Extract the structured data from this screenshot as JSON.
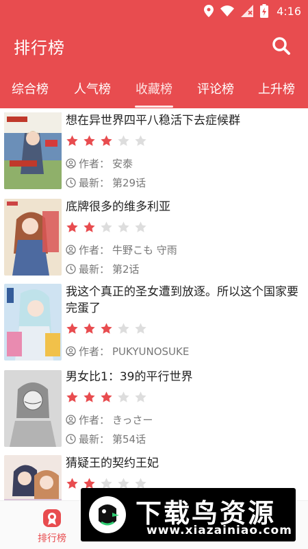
{
  "status_bar": {
    "time": "4:16"
  },
  "header": {
    "title": "排行榜"
  },
  "tabs": [
    {
      "label": "综合榜"
    },
    {
      "label": "人气榜"
    },
    {
      "label": "收藏榜"
    },
    {
      "label": "评论榜"
    },
    {
      "label": "上升榜"
    }
  ],
  "active_tab": "收藏榜",
  "author_prefix": "作者：",
  "latest_prefix": "最新：",
  "items": [
    {
      "title": "想在异世界四平八稳活下去症候群",
      "rating": 3,
      "author": "安泰",
      "latest": "第29话"
    },
    {
      "title": "底牌很多的维多利亚",
      "rating": 2,
      "author": "牛野こも 守雨",
      "latest": "第2话"
    },
    {
      "title": "我这个真正的圣女遭到放逐。所以这个国家要完蛋了",
      "rating": 3,
      "author": "PUKYUNOSUKE",
      "latest": ""
    },
    {
      "title": "男女比1：39的平行世界",
      "rating": 3,
      "author": "きっさー",
      "latest": "第54话"
    },
    {
      "title": "猜疑王的契约王妃",
      "rating": 2,
      "author": "",
      "latest": ""
    }
  ],
  "bottom_nav": {
    "rank_label": "排行榜"
  },
  "watermark": {
    "big": "下载鸟资源",
    "small": "www.xiazainiao.com"
  },
  "colors": {
    "primary": "#e84c4f",
    "star_on": "#e84c4f",
    "star_off": "#dddddd"
  }
}
